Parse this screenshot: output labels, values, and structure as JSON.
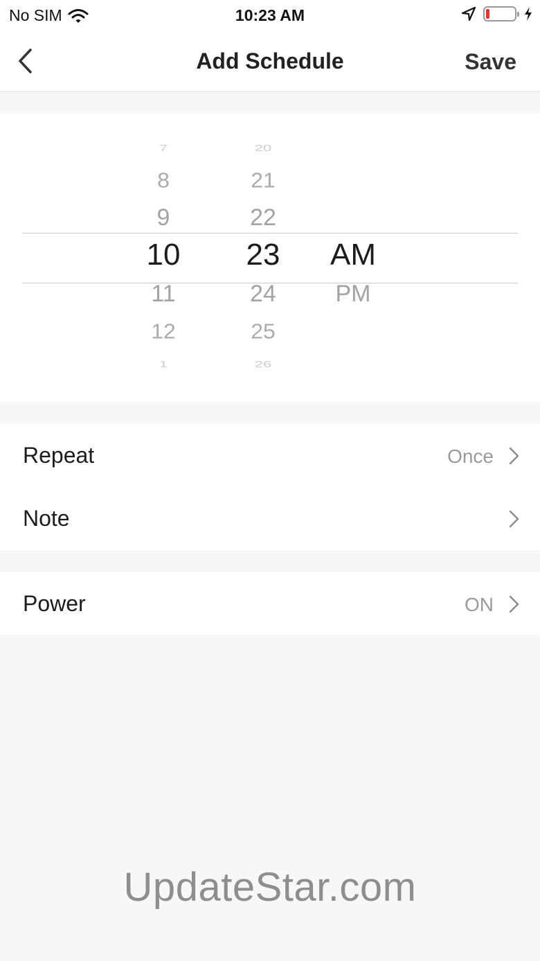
{
  "status_bar": {
    "carrier": "No SIM",
    "time": "10:23 AM",
    "battery_level": 0.12,
    "icons": [
      "wifi-icon",
      "location-arrow-icon",
      "battery-icon",
      "charging-bolt-icon"
    ]
  },
  "nav": {
    "title": "Add Schedule",
    "save_label": "Save",
    "back_icon": "chevron-left-icon"
  },
  "picker": {
    "hours": [
      "7",
      "8",
      "9",
      "10",
      "11",
      "12",
      "1"
    ],
    "minutes": [
      "20",
      "21",
      "22",
      "23",
      "24",
      "25",
      "26"
    ],
    "periods": [
      "AM",
      "PM"
    ],
    "selected": {
      "hour": "10",
      "minute": "23",
      "period": "AM"
    }
  },
  "settings": {
    "repeat": {
      "label": "Repeat",
      "value": "Once"
    },
    "note": {
      "label": "Note"
    },
    "power": {
      "label": "Power",
      "value": "ON"
    }
  },
  "watermark": "UpdateStar.com",
  "colors": {
    "accent_text": "#222222",
    "muted": "#9a9a9a",
    "background": "#f7f7f7",
    "battery_low": "#e8362d"
  }
}
